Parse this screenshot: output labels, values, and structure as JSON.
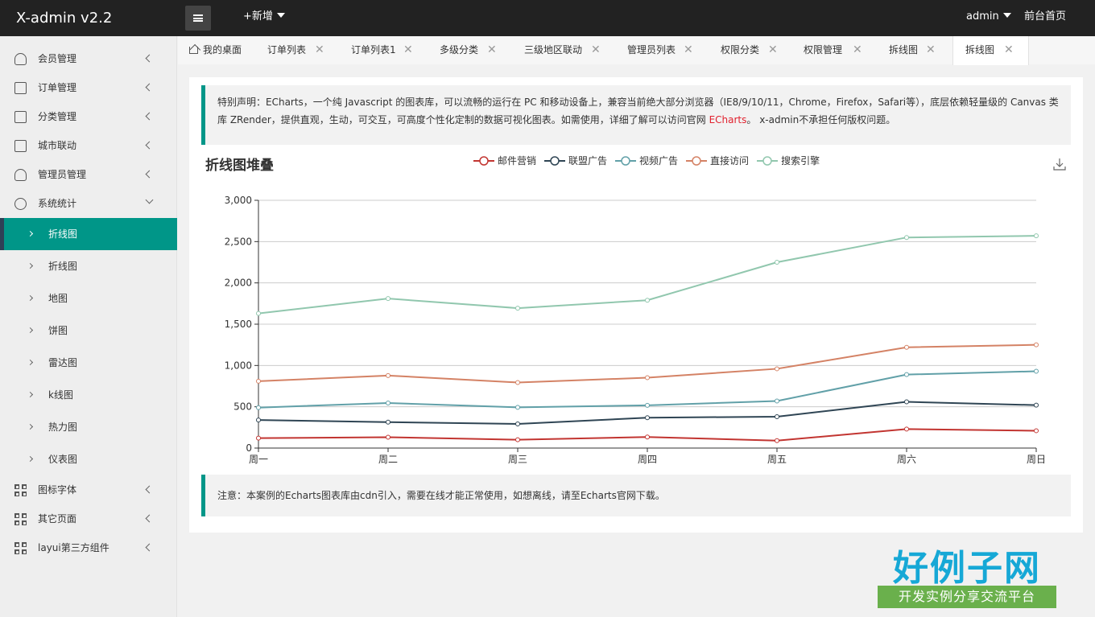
{
  "header": {
    "logo": "X-admin v2.2",
    "add_label": "+新增",
    "user_label": "admin",
    "front_label": "前台首页"
  },
  "sidebar": {
    "groups_top": [
      {
        "label": "会员管理",
        "icon": "user-icon"
      },
      {
        "label": "订单管理",
        "icon": "order-icon"
      },
      {
        "label": "分类管理",
        "icon": "category-icon"
      },
      {
        "label": "城市联动",
        "icon": "city-icon"
      },
      {
        "label": "管理员管理",
        "icon": "admin-icon"
      },
      {
        "label": "系统统计",
        "icon": "stats-icon"
      }
    ],
    "sub_items": [
      {
        "label": "折线图",
        "active": true
      },
      {
        "label": "折线图"
      },
      {
        "label": "地图"
      },
      {
        "label": "饼图"
      },
      {
        "label": "雷达图"
      },
      {
        "label": "k线图"
      },
      {
        "label": "热力图"
      },
      {
        "label": "仪表图"
      }
    ],
    "groups_bottom": [
      {
        "label": "图标字体",
        "icon": "grid-icon"
      },
      {
        "label": "其它页面",
        "icon": "grid-icon"
      },
      {
        "label": "layui第三方组件",
        "icon": "grid-icon"
      }
    ]
  },
  "tabs": [
    {
      "label": "我的桌面",
      "closable": false
    },
    {
      "label": "订单列表",
      "closable": true
    },
    {
      "label": "订单列表1",
      "closable": true
    },
    {
      "label": "多级分类",
      "closable": true
    },
    {
      "label": "三级地区联动",
      "closable": true
    },
    {
      "label": "管理员列表",
      "closable": true
    },
    {
      "label": "权限分类",
      "closable": true
    },
    {
      "label": "权限管理",
      "closable": true
    },
    {
      "label": "拆线图",
      "closable": true
    },
    {
      "label": "拆线图",
      "closable": true,
      "active": true
    }
  ],
  "close_glyph": "✕",
  "notice_top": {
    "text_before": "特别声明：ECharts，一个纯 Javascript 的图表库，可以流畅的运行在 PC 和移动设备上，兼容当前绝大部分浏览器（IE8/9/10/11，Chrome，Firefox，Safari等），底层依赖轻量级的 Canvas 类库 ZRender，提供直观，生动，可交互，可高度个性化定制的数据可视化图表。如需使用，详细了解可以访问官网 ",
    "link": "ECharts",
    "text_after": "。 x-admin不承担任何版权问题。"
  },
  "notice_bottom": "注意：本案例的Echarts图表库由cdn引入，需要在线才能正常使用，如想离线，请至Echarts官网下载。",
  "watermark": {
    "title": "好例子网",
    "subtitle": "开发实例分享交流平台"
  },
  "chart_data": {
    "type": "line",
    "title": "折线图堆叠",
    "categories": [
      "周一",
      "周二",
      "周三",
      "周四",
      "周五",
      "周六",
      "周日"
    ],
    "ylim": [
      0,
      3000
    ],
    "yticks": [
      0,
      500,
      1000,
      1500,
      2000,
      2500,
      3000
    ],
    "ytick_labels": [
      "0",
      "500",
      "1,000",
      "1,500",
      "2,000",
      "2,500",
      "3,000"
    ],
    "grid": true,
    "legend_position": "top-center",
    "series": [
      {
        "name": "邮件营销",
        "color": "#c23531",
        "values": [
          120,
          132,
          101,
          134,
          90,
          230,
          210
        ]
      },
      {
        "name": "联盟广告",
        "color": "#2f4554",
        "values": [
          340,
          314,
          292,
          368,
          380,
          560,
          520
        ]
      },
      {
        "name": "视频广告",
        "color": "#61a0a8",
        "values": [
          490,
          546,
          493,
          518,
          570,
          890,
          930
        ]
      },
      {
        "name": "直接访问",
        "color": "#d48265",
        "values": [
          810,
          878,
          794,
          852,
          960,
          1220,
          1250
        ]
      },
      {
        "name": "搜索引擎",
        "color": "#91c7ae",
        "values": [
          1630,
          1810,
          1694,
          1790,
          2250,
          2550,
          2570
        ]
      }
    ]
  }
}
